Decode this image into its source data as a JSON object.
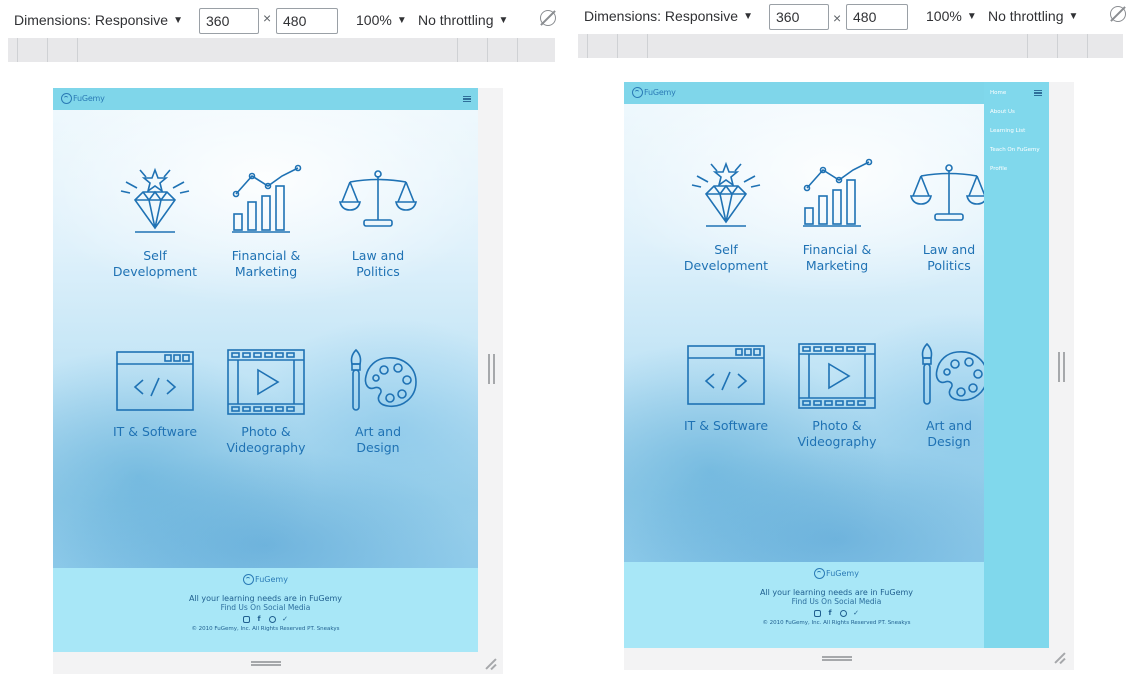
{
  "devtools": {
    "dimensions_label": "Dimensions: Responsive",
    "width_value": "360",
    "times": "×",
    "height_value": "480",
    "zoom": "100%",
    "throttle": "No throttling",
    "caret": "▼"
  },
  "site": {
    "logo_text": "FuGemy",
    "categories": [
      {
        "label": "Self\nDevelopment",
        "icon": "diamond-icon"
      },
      {
        "label": "Financial &\nMarketing",
        "icon": "chart-icon"
      },
      {
        "label": "Law and\nPolitics",
        "icon": "scales-icon"
      },
      {
        "label": "IT & Software",
        "icon": "code-window-icon"
      },
      {
        "label": "Photo &\nVideography",
        "icon": "film-play-icon"
      },
      {
        "label": "Art and\nDesign",
        "icon": "palette-icon"
      }
    ],
    "footer": {
      "tagline": "All your learning needs are in FuGemy",
      "social_heading": "Find Us On Social Media",
      "social_icons": [
        "instagram-icon",
        "facebook-icon",
        "whatsapp-icon",
        "twitter-icon"
      ],
      "social_glyphs": [
        "",
        "f",
        "",
        "✓"
      ],
      "copyright": "© 2010 FuGemy, Inc. All Rights Reserved PT. Sneakys"
    },
    "nav_menu": [
      "Home",
      "About Us",
      "Learning List",
      "Teach On FuGemy",
      "Profile"
    ]
  },
  "colors": {
    "header": "#7fd6ea",
    "footer": "#a8e7f7",
    "icon_blue": "#1f72b4",
    "nav_panel": "#80d8ec"
  }
}
